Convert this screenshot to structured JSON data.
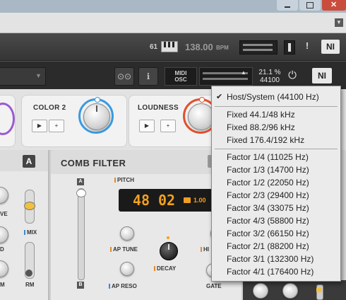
{
  "host_toolbar": {
    "midi_channel": "61",
    "tempo": "138.00",
    "tempo_unit": "BPM"
  },
  "plugin_header": {
    "midi_label": "MIDI",
    "osc_label": "OSC",
    "cpu_percent": "21.1 %",
    "sample_rate": "44100"
  },
  "macros": {
    "color2_label": "COLOR 2",
    "loudness_label": "LOUDNESS",
    "play_symbol": "▶",
    "plus_symbol": "+"
  },
  "left_panel": {
    "badge": "A",
    "mix_label": "MIX",
    "rm_label": "RM",
    "ve_label": "VE",
    "d_label": "D",
    "m_label": "M"
  },
  "comb_filter": {
    "title": "COMB FILTER",
    "pitch_label": "PITCH",
    "lcd_value1": "48",
    "lcd_value2": "02",
    "lcd_small": "1.00",
    "slider_top": "A",
    "slider_bottom": "B",
    "ap_tune_label": "AP TUNE",
    "decay_label": "DECAY",
    "hi_label": "HI",
    "ap_reso_label": "AP RESO",
    "gate_label": "GATE"
  },
  "sample_rate_menu": {
    "selected_index": 0,
    "groups": [
      [
        "Host/System (44100 Hz)"
      ],
      [
        "Fixed 44.1/48 kHz",
        "Fixed 88.2/96 kHz",
        "Fixed 176.4/192 kHz"
      ],
      [
        "Factor 1/4 (11025 Hz)",
        "Factor 1/3 (14700 Hz)",
        "Factor 1/2 (22050 Hz)",
        "Factor 2/3 (29400 Hz)",
        "Factor 3/4 (33075 Hz)",
        "Factor 4/3 (58800 Hz)",
        "Factor 3/2 (66150 Hz)",
        "Factor 2/1 (88200 Hz)",
        "Factor 3/1 (132300 Hz)",
        "Factor 4/1 (176400 Hz)"
      ]
    ]
  },
  "colors": {
    "accent_orange": "#f0a020",
    "knob_ring_blue": "#3a9ae0",
    "knob_ring_red": "#e05030",
    "knob_ring_purple": "#9a5ad0"
  }
}
